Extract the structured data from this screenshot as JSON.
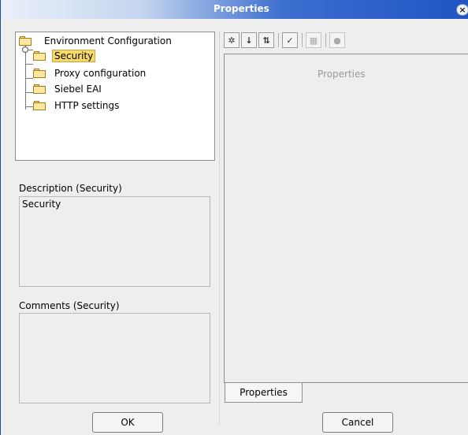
{
  "window": {
    "title": "Properties",
    "close_glyph": "×",
    "colors": {
      "titlebar_dark": "#1f54c3",
      "selection": "#f7d96a",
      "background": "#eeeeee"
    }
  },
  "tree": {
    "root": "Environment Configuration",
    "items": [
      {
        "label": "Security",
        "selected": true,
        "icon": "folder-icon"
      },
      {
        "label": "Proxy configuration",
        "selected": false,
        "icon": "folder-icon"
      },
      {
        "label": "Siebel EAI",
        "selected": false,
        "icon": "folder-icon"
      },
      {
        "label": "HTTP settings",
        "selected": false,
        "icon": "folder-icon"
      }
    ]
  },
  "description": {
    "label": "Description (Security)",
    "value": "Security"
  },
  "comments": {
    "label": "Comments (Security)",
    "value": ""
  },
  "toolbar": {
    "buttons": [
      {
        "icon": "categorized-icon",
        "glyph": "✲"
      },
      {
        "icon": "sort-alpha-icon",
        "glyph": "↓"
      },
      {
        "icon": "sort-order-icon",
        "glyph": "⇅"
      },
      {
        "icon": "checklist-icon",
        "glyph": "✓"
      },
      {
        "icon": "table-icon",
        "glyph": "▦"
      },
      {
        "icon": "help-icon",
        "glyph": "●"
      }
    ]
  },
  "properties_panel": {
    "placeholder": "Properties",
    "tab_label": "Properties"
  },
  "buttons": {
    "ok": "OK",
    "cancel": "Cancel"
  }
}
